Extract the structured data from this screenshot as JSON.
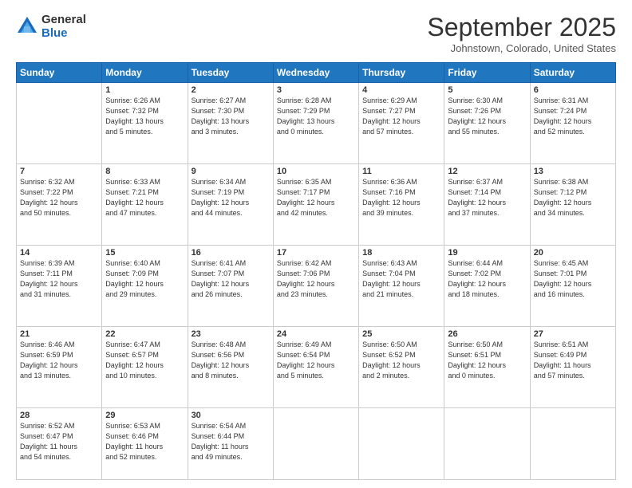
{
  "header": {
    "logo": {
      "general": "General",
      "blue": "Blue"
    },
    "title": "September 2025",
    "subtitle": "Johnstown, Colorado, United States"
  },
  "calendar": {
    "days_of_week": [
      "Sunday",
      "Monday",
      "Tuesday",
      "Wednesday",
      "Thursday",
      "Friday",
      "Saturday"
    ],
    "weeks": [
      [
        {
          "day": "",
          "info": ""
        },
        {
          "day": "1",
          "info": "Sunrise: 6:26 AM\nSunset: 7:32 PM\nDaylight: 13 hours\nand 5 minutes."
        },
        {
          "day": "2",
          "info": "Sunrise: 6:27 AM\nSunset: 7:30 PM\nDaylight: 13 hours\nand 3 minutes."
        },
        {
          "day": "3",
          "info": "Sunrise: 6:28 AM\nSunset: 7:29 PM\nDaylight: 13 hours\nand 0 minutes."
        },
        {
          "day": "4",
          "info": "Sunrise: 6:29 AM\nSunset: 7:27 PM\nDaylight: 12 hours\nand 57 minutes."
        },
        {
          "day": "5",
          "info": "Sunrise: 6:30 AM\nSunset: 7:26 PM\nDaylight: 12 hours\nand 55 minutes."
        },
        {
          "day": "6",
          "info": "Sunrise: 6:31 AM\nSunset: 7:24 PM\nDaylight: 12 hours\nand 52 minutes."
        }
      ],
      [
        {
          "day": "7",
          "info": "Sunrise: 6:32 AM\nSunset: 7:22 PM\nDaylight: 12 hours\nand 50 minutes."
        },
        {
          "day": "8",
          "info": "Sunrise: 6:33 AM\nSunset: 7:21 PM\nDaylight: 12 hours\nand 47 minutes."
        },
        {
          "day": "9",
          "info": "Sunrise: 6:34 AM\nSunset: 7:19 PM\nDaylight: 12 hours\nand 44 minutes."
        },
        {
          "day": "10",
          "info": "Sunrise: 6:35 AM\nSunset: 7:17 PM\nDaylight: 12 hours\nand 42 minutes."
        },
        {
          "day": "11",
          "info": "Sunrise: 6:36 AM\nSunset: 7:16 PM\nDaylight: 12 hours\nand 39 minutes."
        },
        {
          "day": "12",
          "info": "Sunrise: 6:37 AM\nSunset: 7:14 PM\nDaylight: 12 hours\nand 37 minutes."
        },
        {
          "day": "13",
          "info": "Sunrise: 6:38 AM\nSunset: 7:12 PM\nDaylight: 12 hours\nand 34 minutes."
        }
      ],
      [
        {
          "day": "14",
          "info": "Sunrise: 6:39 AM\nSunset: 7:11 PM\nDaylight: 12 hours\nand 31 minutes."
        },
        {
          "day": "15",
          "info": "Sunrise: 6:40 AM\nSunset: 7:09 PM\nDaylight: 12 hours\nand 29 minutes."
        },
        {
          "day": "16",
          "info": "Sunrise: 6:41 AM\nSunset: 7:07 PM\nDaylight: 12 hours\nand 26 minutes."
        },
        {
          "day": "17",
          "info": "Sunrise: 6:42 AM\nSunset: 7:06 PM\nDaylight: 12 hours\nand 23 minutes."
        },
        {
          "day": "18",
          "info": "Sunrise: 6:43 AM\nSunset: 7:04 PM\nDaylight: 12 hours\nand 21 minutes."
        },
        {
          "day": "19",
          "info": "Sunrise: 6:44 AM\nSunset: 7:02 PM\nDaylight: 12 hours\nand 18 minutes."
        },
        {
          "day": "20",
          "info": "Sunrise: 6:45 AM\nSunset: 7:01 PM\nDaylight: 12 hours\nand 16 minutes."
        }
      ],
      [
        {
          "day": "21",
          "info": "Sunrise: 6:46 AM\nSunset: 6:59 PM\nDaylight: 12 hours\nand 13 minutes."
        },
        {
          "day": "22",
          "info": "Sunrise: 6:47 AM\nSunset: 6:57 PM\nDaylight: 12 hours\nand 10 minutes."
        },
        {
          "day": "23",
          "info": "Sunrise: 6:48 AM\nSunset: 6:56 PM\nDaylight: 12 hours\nand 8 minutes."
        },
        {
          "day": "24",
          "info": "Sunrise: 6:49 AM\nSunset: 6:54 PM\nDaylight: 12 hours\nand 5 minutes."
        },
        {
          "day": "25",
          "info": "Sunrise: 6:50 AM\nSunset: 6:52 PM\nDaylight: 12 hours\nand 2 minutes."
        },
        {
          "day": "26",
          "info": "Sunrise: 6:50 AM\nSunset: 6:51 PM\nDaylight: 12 hours\nand 0 minutes."
        },
        {
          "day": "27",
          "info": "Sunrise: 6:51 AM\nSunset: 6:49 PM\nDaylight: 11 hours\nand 57 minutes."
        }
      ],
      [
        {
          "day": "28",
          "info": "Sunrise: 6:52 AM\nSunset: 6:47 PM\nDaylight: 11 hours\nand 54 minutes."
        },
        {
          "day": "29",
          "info": "Sunrise: 6:53 AM\nSunset: 6:46 PM\nDaylight: 11 hours\nand 52 minutes."
        },
        {
          "day": "30",
          "info": "Sunrise: 6:54 AM\nSunset: 6:44 PM\nDaylight: 11 hours\nand 49 minutes."
        },
        {
          "day": "",
          "info": ""
        },
        {
          "day": "",
          "info": ""
        },
        {
          "day": "",
          "info": ""
        },
        {
          "day": "",
          "info": ""
        }
      ]
    ]
  }
}
